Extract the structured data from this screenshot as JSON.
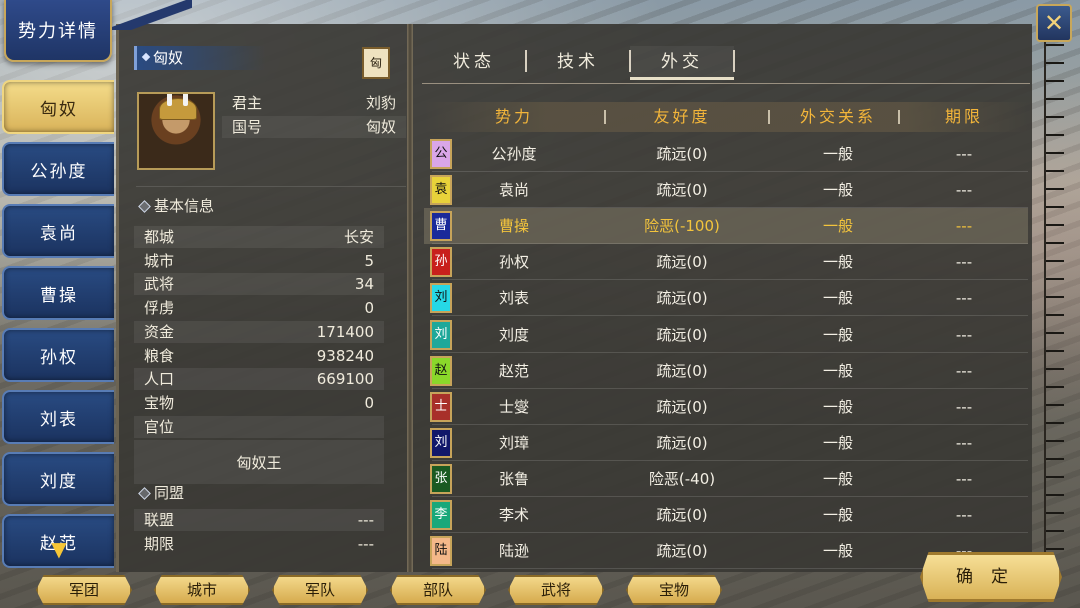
{
  "window": {
    "title": "势力详情",
    "close_icon": "crossed-swords-icon"
  },
  "sidebar": {
    "factions": [
      {
        "label": "匈奴",
        "active": true
      },
      {
        "label": "公孙度",
        "active": false
      },
      {
        "label": "袁尚",
        "active": false
      },
      {
        "label": "曹操",
        "active": false
      },
      {
        "label": "孙权",
        "active": false
      },
      {
        "label": "刘表",
        "active": false
      },
      {
        "label": "刘度",
        "active": false
      },
      {
        "label": "赵范",
        "active": false
      }
    ],
    "scroll_icon": "chevron-down-icon"
  },
  "info": {
    "faction_name": "匈奴",
    "seal_text": "匈",
    "ruler_label": "君主",
    "ruler_value": "刘豹",
    "country_label": "国号",
    "country_value": "匈奴",
    "basic_section": "基本信息",
    "stats": [
      {
        "label": "都城",
        "value": "长安"
      },
      {
        "label": "城市",
        "value": "5"
      },
      {
        "label": "武将",
        "value": "34"
      },
      {
        "label": "俘虏",
        "value": "0"
      },
      {
        "label": "资金",
        "value": "171400"
      },
      {
        "label": "粮食",
        "value": "938240"
      },
      {
        "label": "人口",
        "value": "669100"
      },
      {
        "label": "宝物",
        "value": "0"
      },
      {
        "label": "官位",
        "value": ""
      }
    ],
    "title_value": "匈奴王",
    "alliance_section": "同盟",
    "alliance": [
      {
        "label": "联盟",
        "value": "---"
      },
      {
        "label": "期限",
        "value": "---"
      }
    ]
  },
  "tabs": [
    {
      "label": "状态",
      "active": false
    },
    {
      "label": "技术",
      "active": false
    },
    {
      "label": "外交",
      "active": true
    }
  ],
  "table": {
    "headers": [
      "势力",
      "友好度",
      "外交关系",
      "期限"
    ],
    "rows": [
      {
        "flag": "公",
        "color": "#d9a6e8",
        "name": "公孙度",
        "friendship": "疏远(0)",
        "relation": "一般",
        "term": "---"
      },
      {
        "flag": "袁",
        "color": "#e8d23a",
        "name": "袁尚",
        "friendship": "疏远(0)",
        "relation": "一般",
        "term": "---"
      },
      {
        "flag": "曹",
        "color": "#1a2a9a",
        "name": "曹操",
        "friendship": "险恶(-100)",
        "relation": "一般",
        "term": "---",
        "highlight": true
      },
      {
        "flag": "孙",
        "color": "#c8201c",
        "name": "孙权",
        "friendship": "疏远(0)",
        "relation": "一般",
        "term": "---"
      },
      {
        "flag": "刘",
        "color": "#26d8e6",
        "name": "刘表",
        "friendship": "疏远(0)",
        "relation": "一般",
        "term": "---"
      },
      {
        "flag": "刘",
        "color": "#1fa89a",
        "name": "刘度",
        "friendship": "疏远(0)",
        "relation": "一般",
        "term": "---"
      },
      {
        "flag": "赵",
        "color": "#8ad82a",
        "name": "赵范",
        "friendship": "疏远(0)",
        "relation": "一般",
        "term": "---"
      },
      {
        "flag": "士",
        "color": "#a8302a",
        "name": "士燮",
        "friendship": "疏远(0)",
        "relation": "一般",
        "term": "---"
      },
      {
        "flag": "刘",
        "color": "#12186a",
        "name": "刘璋",
        "friendship": "疏远(0)",
        "relation": "一般",
        "term": "---"
      },
      {
        "flag": "张",
        "color": "#1a5a22",
        "name": "张鲁",
        "friendship": "险恶(-40)",
        "relation": "一般",
        "term": "---"
      },
      {
        "flag": "李",
        "color": "#18a87a",
        "name": "李术",
        "friendship": "疏远(0)",
        "relation": "一般",
        "term": "---"
      },
      {
        "flag": "陆",
        "color": "#f4b889",
        "name": "陆逊",
        "friendship": "疏远(0)",
        "relation": "一般",
        "term": "---"
      }
    ]
  },
  "bottom_nav": [
    "军团",
    "城市",
    "军队",
    "部队",
    "武将",
    "宝物"
  ],
  "confirm_label": "确定"
}
